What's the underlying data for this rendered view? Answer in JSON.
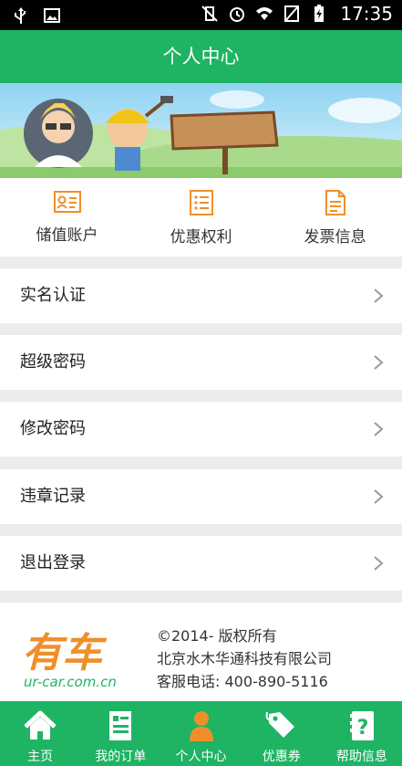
{
  "statusbar": {
    "time": "17:35"
  },
  "header": {
    "title": "个人中心"
  },
  "quick_actions": [
    {
      "label": "储值账户",
      "icon": "id-card-icon"
    },
    {
      "label": "优惠权利",
      "icon": "list-icon"
    },
    {
      "label": "发票信息",
      "icon": "invoice-icon"
    }
  ],
  "menu": [
    {
      "label": "实名认证"
    },
    {
      "label": "超级密码"
    },
    {
      "label": "修改密码"
    },
    {
      "label": "违章记录"
    },
    {
      "label": "退出登录"
    }
  ],
  "footer": {
    "copyright": "©2014- 版权所有",
    "company": "北京水木华通科技有限公司",
    "hotline": "客服电话: 400-890-5116",
    "logo_text": "有车",
    "logo_url": "ur-car.com.cn"
  },
  "tabs": [
    {
      "label": "主页",
      "icon": "home-icon"
    },
    {
      "label": "我的订单",
      "icon": "orders-icon"
    },
    {
      "label": "个人中心",
      "icon": "person-icon",
      "active": true
    },
    {
      "label": "优惠券",
      "icon": "coupon-tag-icon"
    },
    {
      "label": "帮助信息",
      "icon": "help-book-icon"
    }
  ],
  "colors": {
    "brand_green": "#1fb364",
    "accent_orange": "#ef8f2a"
  }
}
